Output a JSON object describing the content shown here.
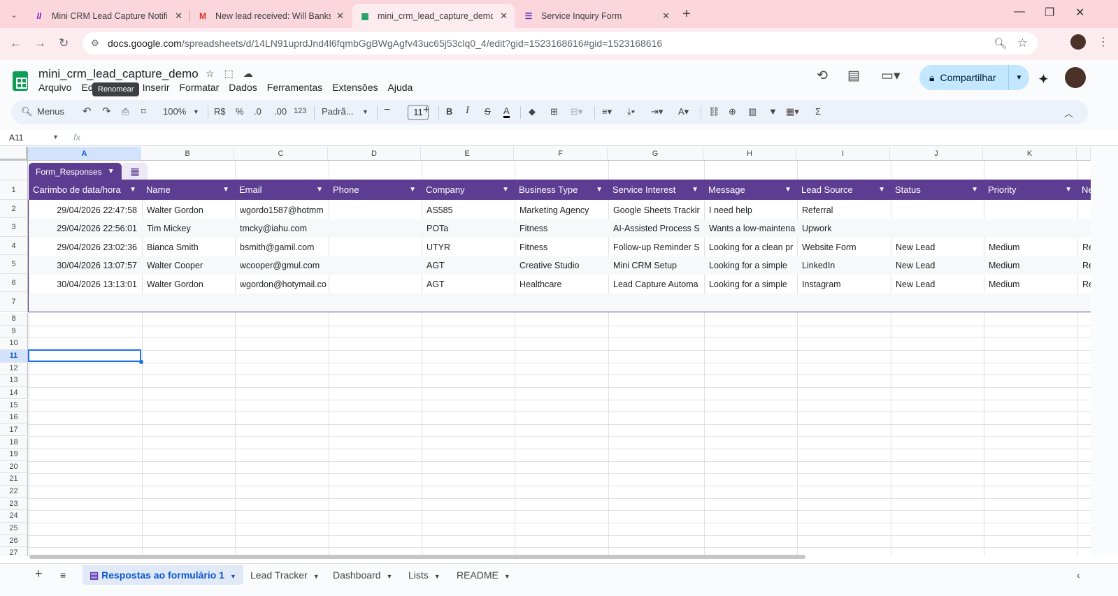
{
  "browser": {
    "tabs": [
      {
        "title": "Mini CRM Lead Capture Notific",
        "icon": "make-icon",
        "color": "#6d00cc"
      },
      {
        "title": "New lead received: Will Banks (F",
        "icon": "gmail-icon",
        "color": "#d93025"
      },
      {
        "title": "mini_crm_lead_capture_demo -",
        "icon": "sheets-icon",
        "color": "#0f9d58"
      },
      {
        "title": "Service Inquiry Form",
        "icon": "forms-icon",
        "color": "#673ab7"
      }
    ],
    "url_host": "docs.google.com",
    "url_path": "/spreadsheets/d/14LN91uprdJnd4l6fqmbGgBWgAgfv43uc65j53clq0_4/edit?gid=1523168616#gid=1523168616"
  },
  "doc": {
    "title": "mini_crm_lead_capture_demo",
    "menus": [
      "Arquivo",
      "Ed",
      "Inserir",
      "Formatar",
      "Dados",
      "Ferramentas",
      "Extensões",
      "Ajuda"
    ],
    "tooltip": "Renomear",
    "share_label": "Compartilhar"
  },
  "toolbar": {
    "search": "Menus",
    "zoom": "100%",
    "currency": "R$",
    "percent": "%",
    "dec_dec": ".0",
    "dec_inc": ".00",
    "numfmt": "123",
    "font": "Padrã...",
    "font_size": "11"
  },
  "formula_bar": {
    "cell_ref": "A11",
    "fx": "fx"
  },
  "grid": {
    "columns": [
      "A",
      "B",
      "C",
      "D",
      "E",
      "F",
      "G",
      "H",
      "I",
      "J",
      "K"
    ],
    "rows": [
      "1",
      "2",
      "3",
      "4",
      "5",
      "6",
      "7",
      "8",
      "9",
      "10",
      "11",
      "12",
      "13",
      "14",
      "15",
      "16",
      "17",
      "18",
      "19",
      "20",
      "21",
      "22",
      "23",
      "24",
      "25",
      "26",
      "27"
    ],
    "table_name": "Form_Responses",
    "headers": [
      "Carimbo de data/hora",
      "Name",
      "Email",
      "Phone",
      "Company",
      "Business Type",
      "Service Interest",
      "Message",
      "Lead Source",
      "Status",
      "Priority",
      "Ne"
    ],
    "data": [
      [
        "29/04/2026 22:47:58",
        "Walter Gordon",
        "wgordo1587@hotmm",
        "",
        "AS585",
        "Marketing Agency",
        "Google Sheets Trackir",
        "I need help",
        "Referral",
        "",
        "",
        ""
      ],
      [
        "29/04/2026 22:56:01",
        "Tim Mickey",
        "tmcky@iahu.com",
        "",
        "POTa",
        "Fitness",
        "AI-Assisted Process S",
        "Wants a low-maintena",
        "Upwork",
        "",
        "",
        ""
      ],
      [
        "29/04/2026 23:02:36",
        "Bianca Smith",
        "bsmith@gamil.com",
        "",
        "UTYR",
        "Fitness",
        "Follow-up Reminder S",
        "Looking for a clean pr",
        "Website Form",
        "New Lead",
        "Medium",
        "Re"
      ],
      [
        "30/04/2026 13:07:57",
        "Walter Cooper",
        "wcooper@gmul.com",
        "",
        "AGT",
        "Creative Studio",
        "Mini CRM Setup",
        "Looking for a simple",
        "LinkedIn",
        "New Lead",
        "Medium",
        "Re"
      ],
      [
        "30/04/2026 13:13:01",
        "Walter Gordon",
        "wgordon@hotymail.co",
        "",
        "AGT",
        "Healthcare",
        "Lead Capture Automa",
        "Looking for a simple",
        "Instagram",
        "New Lead",
        "Medium",
        "Re"
      ]
    ]
  },
  "sheets": [
    {
      "label": "Respostas ao formulário 1",
      "active": true
    },
    {
      "label": "Lead Tracker",
      "active": false
    },
    {
      "label": "Dashboard",
      "active": false
    },
    {
      "label": "Lists",
      "active": false
    },
    {
      "label": "README",
      "active": false
    }
  ],
  "colors": {
    "accent": "#5c3d91",
    "selection": "#1a73e8",
    "share": "#c2e7ff"
  }
}
